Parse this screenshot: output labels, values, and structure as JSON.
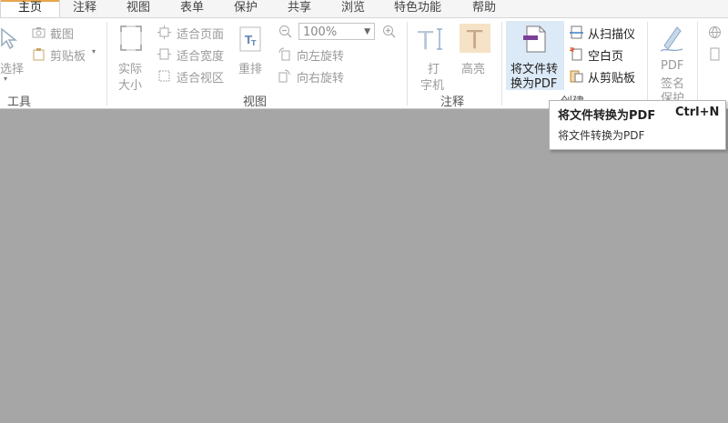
{
  "tabs": [
    {
      "label": "主页",
      "active": true
    },
    {
      "label": "注释"
    },
    {
      "label": "视图"
    },
    {
      "label": "表单"
    },
    {
      "label": "保护"
    },
    {
      "label": "共享"
    },
    {
      "label": "浏览"
    },
    {
      "label": "特色功能"
    },
    {
      "label": "帮助"
    }
  ],
  "tools_group": {
    "select_label": "选择",
    "screenshot_label": "截图",
    "clipboard_label": "剪贴板",
    "group_label": "工具"
  },
  "view_group": {
    "actual_size_line1": "实际",
    "actual_size_line2": "大小",
    "fit_page": "适合页面",
    "fit_width": "适合宽度",
    "fit_view": "适合视区",
    "reflow": "重排",
    "zoom_value": "100%",
    "rotate_left": "向左旋转",
    "rotate_right": "向右旋转",
    "group_label": "视图"
  },
  "annotate_group": {
    "typewriter_line1": "打",
    "typewriter_line2": "字机",
    "highlight": "高亮",
    "group_label": "注释"
  },
  "create_group": {
    "convert_line1": "将文件转",
    "convert_line2": "换为PDF",
    "from_scanner": "从扫描仪",
    "blank_page": "空白页",
    "from_clipboard": "从剪贴板",
    "group_label": "创建"
  },
  "protect_group": {
    "sign_line1": "PDF",
    "sign_line2": "签名",
    "sign_line3": "保护"
  },
  "tooltip": {
    "title": "将文件转换为PDF",
    "shortcut": "Ctrl+N",
    "description": "将文件转换为PDF"
  },
  "colors": {
    "workspace": "#a6a6a6",
    "ribbon": "#ffffff",
    "highlight": "#dce9f6",
    "accent_orange": "#e8a64b",
    "pdf_purple": "#7b3f98"
  }
}
